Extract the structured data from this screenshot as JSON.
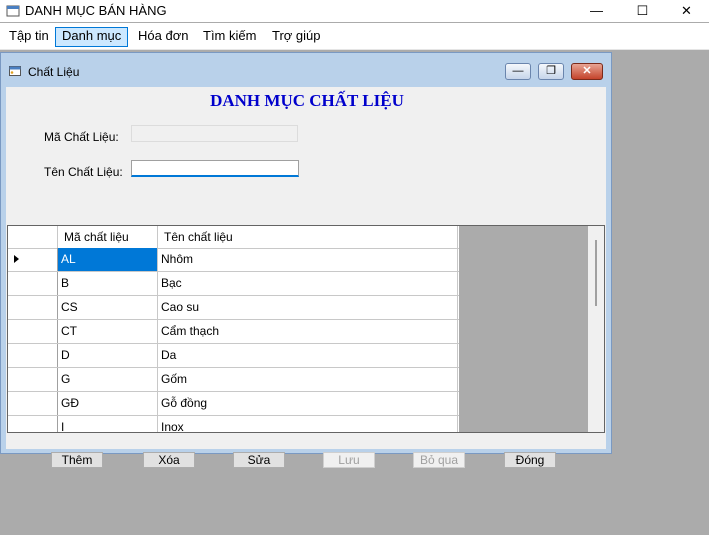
{
  "window": {
    "title": "DANH MỤC BÁN HÀNG",
    "min_glyph": "—",
    "max_glyph": "☐",
    "close_glyph": "✕"
  },
  "menu": [
    {
      "label": "Tập tin"
    },
    {
      "label": "Danh mục",
      "active": true
    },
    {
      "label": "Hóa đơn"
    },
    {
      "label": "Tìm kiếm"
    },
    {
      "label": "Trợ giúp"
    }
  ],
  "child": {
    "title": "Chất Liệu",
    "min_glyph": "—",
    "max_glyph": "❐",
    "close_glyph": "✕",
    "heading": "DANH MỤC CHẤT LIỆU",
    "fields": {
      "ma_label": "Mã Chất Liệu:",
      "ma_value": "",
      "ten_label": "Tên Chất Liệu:",
      "ten_value": ""
    },
    "grid": {
      "columns": [
        "Mã chất liệu",
        "Tên chất liệu"
      ],
      "rows": [
        {
          "code": "AL",
          "name": "Nhôm",
          "selected": true
        },
        {
          "code": "B",
          "name": "Bạc"
        },
        {
          "code": "CS",
          "name": "Cao su"
        },
        {
          "code": "CT",
          "name": "Cẩm thạch"
        },
        {
          "code": "D",
          "name": "Da"
        },
        {
          "code": "G",
          "name": "Gốm"
        },
        {
          "code": "GĐ",
          "name": "Gỗ đồng"
        },
        {
          "code": "I",
          "name": "Inox"
        }
      ]
    },
    "buttons": {
      "them": "Thêm",
      "xoa": "Xóa",
      "sua": "Sửa",
      "luu": "Lưu",
      "boqua": "Bỏ qua",
      "dong": "Đóng"
    }
  },
  "colors": {
    "accent": "#0078d7",
    "heading": "#0000cc",
    "mdi_bg": "#ababab"
  }
}
